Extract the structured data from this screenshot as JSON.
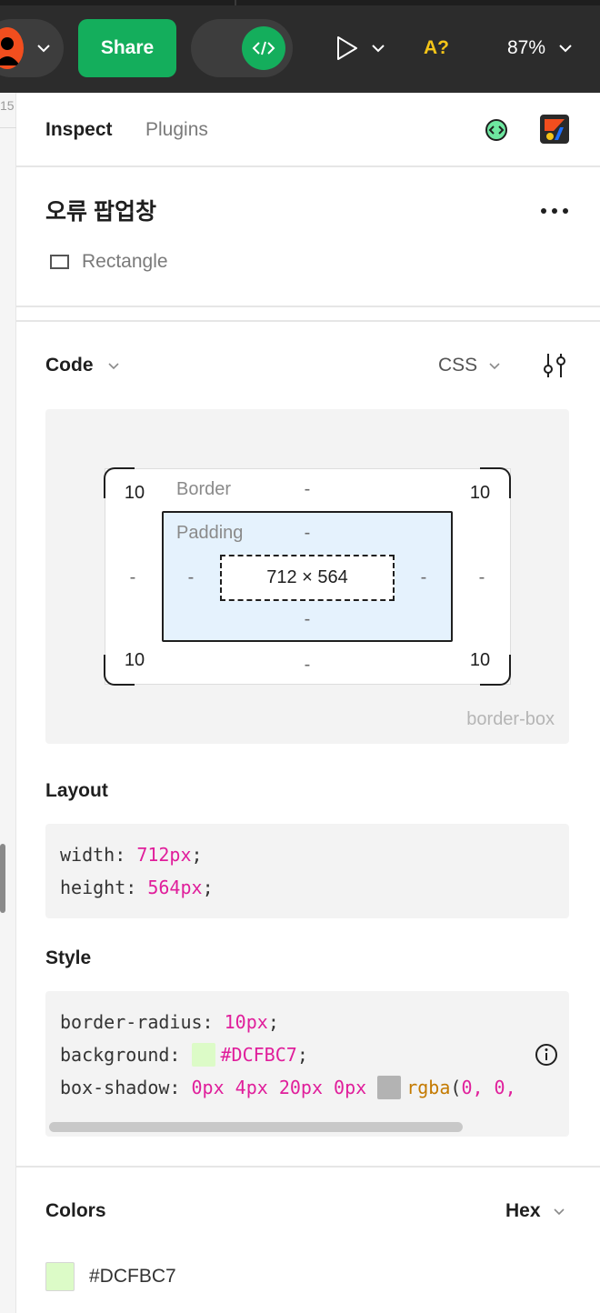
{
  "toolbar": {
    "share_label": "Share",
    "a_label": "A?",
    "zoom_label": "87%"
  },
  "ruler": {
    "visible_number": "15"
  },
  "tabs": [
    {
      "label": "Inspect",
      "active": true
    },
    {
      "label": "Plugins",
      "active": false
    }
  ],
  "layer": {
    "name": "오류 팝업창",
    "type": "Rectangle"
  },
  "code_section": {
    "title": "Code",
    "language": "CSS"
  },
  "box_model": {
    "border_label": "Border",
    "padding_label": "Padding",
    "content_size": "712 × 564",
    "corner_radius_tl": "10",
    "corner_radius_tr": "10",
    "corner_radius_bl": "10",
    "corner_radius_br": "10",
    "border_top": "-",
    "border_left": "-",
    "border_right": "-",
    "border_bottom": "-",
    "padding_top": "-",
    "padding_left": "-",
    "padding_right": "-",
    "padding_bottom": "-",
    "box_sizing": "border-box"
  },
  "layout": {
    "title": "Layout",
    "lines": [
      {
        "prop": "width",
        "value": "712px"
      },
      {
        "prop": "height",
        "value": "564px"
      }
    ]
  },
  "style": {
    "title": "Style",
    "border_radius_prop": "border-radius",
    "border_radius_value": "10px",
    "background_prop": "background",
    "background_value": "#DCFBC7",
    "box_shadow_prop": "box-shadow",
    "box_shadow_offsets": "0px 4px 20px 0px",
    "box_shadow_fn": "rgba",
    "box_shadow_args": "0, 0,"
  },
  "colors": {
    "title": "Colors",
    "format": "Hex",
    "items": [
      {
        "hex": "#DCFBC7"
      }
    ]
  },
  "palette": {
    "accent_green": "#14ae5c",
    "swatch_green": "#dcfbc7",
    "shadow_swatch": "#b3b3b3",
    "code_value_pink": "#e01e9b"
  }
}
